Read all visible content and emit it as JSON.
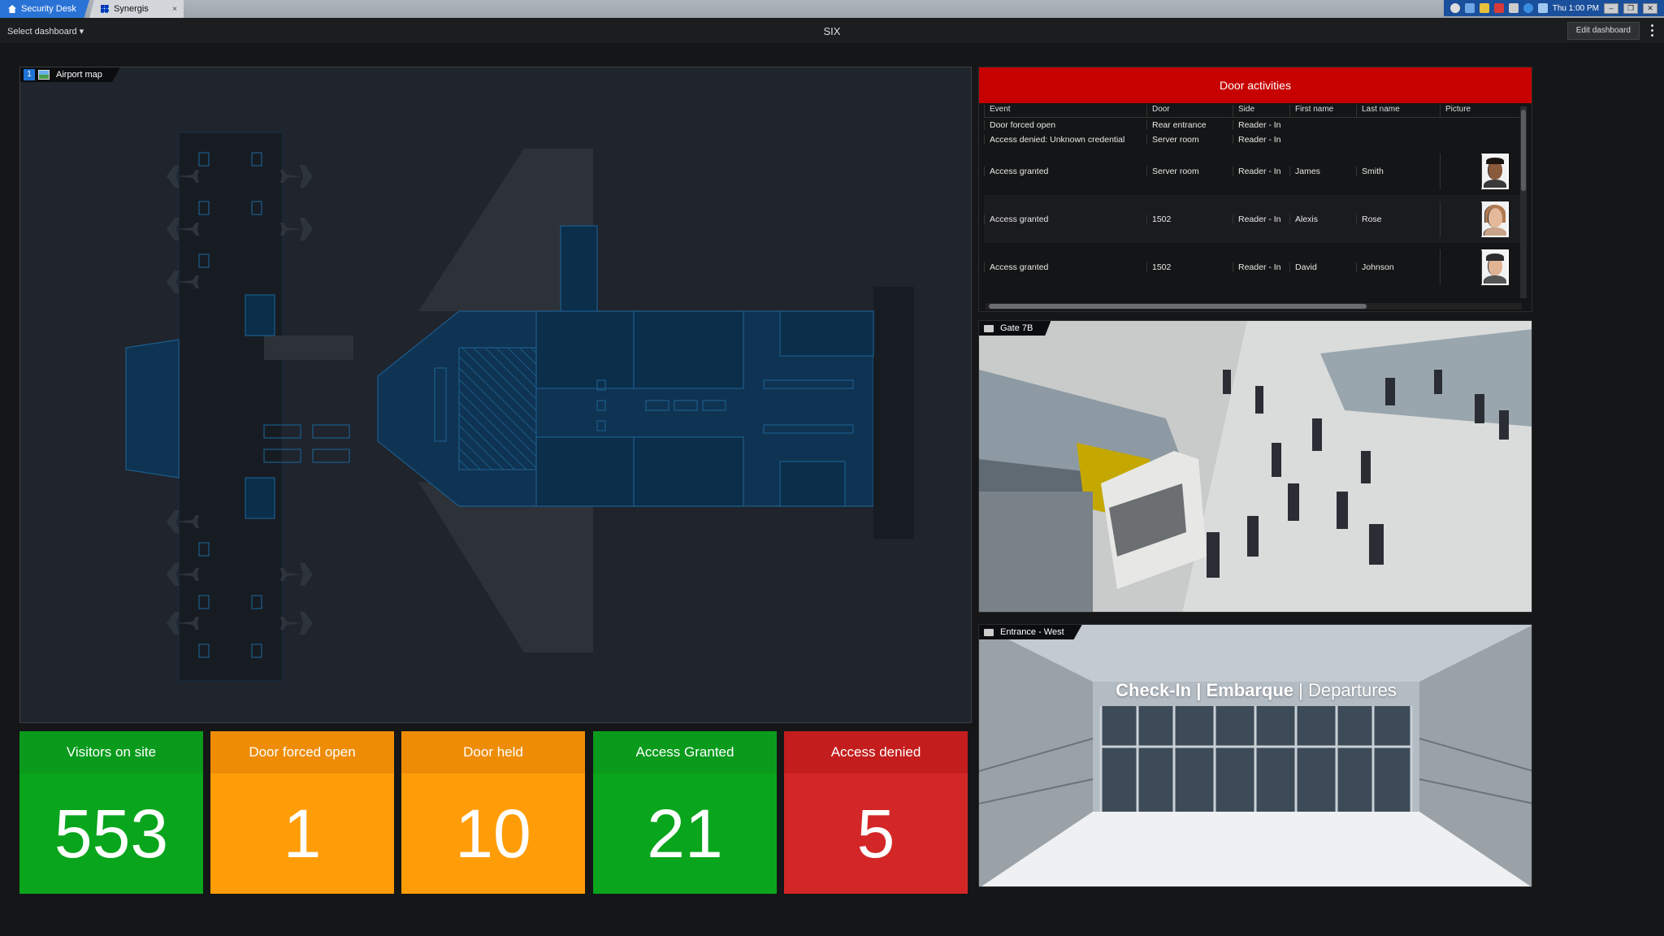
{
  "tabs": [
    {
      "label": "Security Desk",
      "icon": "home-icon",
      "active": true
    },
    {
      "label": "Synergis",
      "icon": "synergis-grid-icon",
      "active": false
    }
  ],
  "tab_close_glyph": "×",
  "system_tray": {
    "clock": "Thu 1:00 PM"
  },
  "dashboard": {
    "select_label": "Select dashboard ▾",
    "title": "SIX",
    "edit_label": "Edit dashboard"
  },
  "map_tile": {
    "number": "1",
    "title": "Airport map"
  },
  "door_activities": {
    "title": "Door activities",
    "columns": [
      "Event",
      "Door",
      "Side",
      "First name",
      "Last name",
      "Picture"
    ],
    "rows": [
      {
        "event": "Door forced open",
        "door": "Rear entrance",
        "side": "Reader - In",
        "first": "",
        "last": ""
      },
      {
        "event": "Access denied: Unknown credential",
        "door": "Server room",
        "side": "Reader - In",
        "first": "",
        "last": ""
      },
      {
        "event": "Access granted",
        "door": "Server room",
        "side": "Reader - In",
        "first": "James",
        "last": "Smith"
      },
      {
        "event": "Access granted",
        "door": "1502",
        "side": "Reader - In",
        "first": "Alexis",
        "last": "Rose"
      },
      {
        "event": "Access granted",
        "door": "1502",
        "side": "Reader - In",
        "first": "David",
        "last": "Johnson"
      }
    ]
  },
  "cameras": {
    "gate": {
      "title": "Gate 7B"
    },
    "entrance": {
      "title": "Entrance - West",
      "sign_bold": "Check-In | Embarque",
      "sign_light": " | Departures"
    }
  },
  "kpis": [
    {
      "label": "Visitors on site",
      "value": "553",
      "color": "green"
    },
    {
      "label": "Door forced open",
      "value": "1",
      "color": "orange"
    },
    {
      "label": "Door held",
      "value": "10",
      "color": "orange"
    },
    {
      "label": "Access Granted",
      "value": "21",
      "color": "green"
    },
    {
      "label": "Access denied",
      "value": "5",
      "color": "red"
    }
  ],
  "colors": {
    "accent_blue": "#1e73d4",
    "alert_red": "#c70000",
    "ok_green": "#09a51c",
    "warn_orange": "#ff9d08",
    "map_blue": "#0a3a5c"
  }
}
